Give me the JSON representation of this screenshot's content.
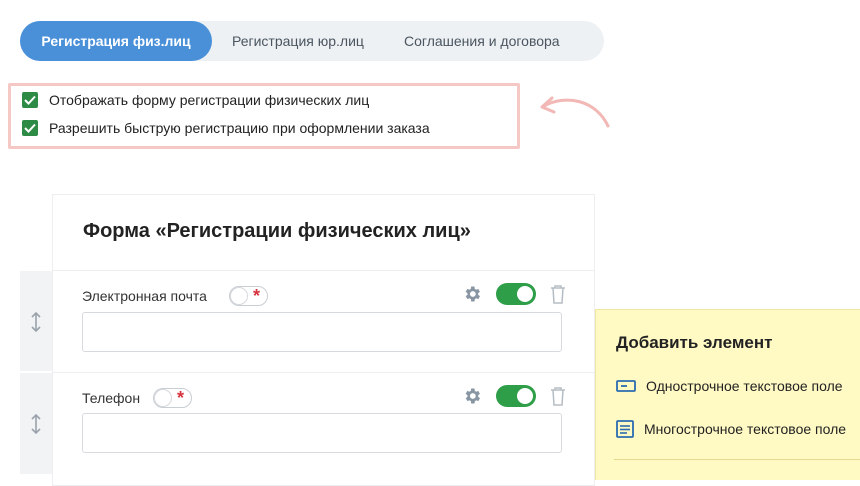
{
  "tabs": [
    {
      "label": "Регистрация физ.лиц",
      "active": true
    },
    {
      "label": "Регистрация юр.лиц",
      "active": false
    },
    {
      "label": "Соглашения и договора",
      "active": false
    }
  ],
  "settings": {
    "show_form_label": "Отображать форму регистрации физических лиц",
    "show_form_checked": true,
    "quick_reg_label": "Разрешить быструю регистрацию при оформлении заказа",
    "quick_reg_checked": true
  },
  "form": {
    "title": "Форма «Регистрации физических лиц»",
    "fields": [
      {
        "label": "Электронная почта",
        "required_icon": "asterisk-icon",
        "enabled": true,
        "value": ""
      },
      {
        "label": "Телефон",
        "required_icon": "asterisk-icon",
        "enabled": true,
        "value": ""
      }
    ]
  },
  "add_panel": {
    "title": "Добавить элемент",
    "items": [
      {
        "label": "Однострочное текстовое поле",
        "icon": "single-line-field-icon"
      },
      {
        "label": "Многострочное текстовое поле",
        "icon": "multi-line-field-icon"
      }
    ]
  },
  "colors": {
    "accent": "#4a90d9",
    "checkbox": "#2e8b45",
    "switch_on": "#2e9e48",
    "required": "#d6333d",
    "highlight_border": "#f5c8c6",
    "panel_bg": "#fff9c4"
  }
}
